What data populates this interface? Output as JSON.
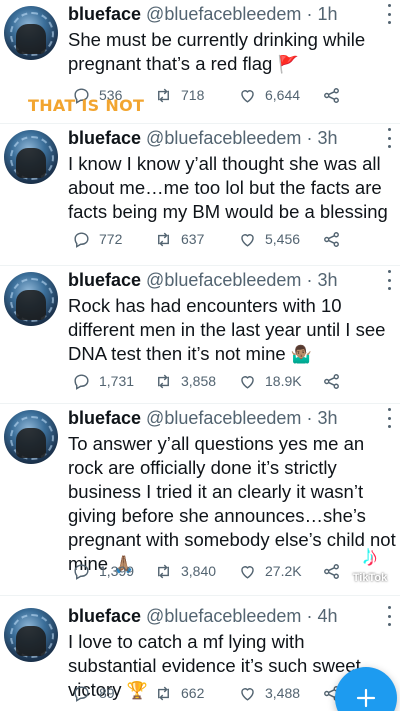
{
  "tweets": [
    {
      "name": "blueface",
      "handle": "@bluefacebleedem",
      "time": "1h",
      "text": "She must be currently drinking while pregnant that’s a red flag",
      "emoji": "🚩",
      "replies": "536",
      "retweets": "718",
      "likes": "6,644"
    },
    {
      "name": "blueface",
      "handle": "@bluefacebleedem",
      "time": "3h",
      "text": "I know I know y’all thought she was all about me…me too lol but the facts are facts being my BM would be a blessing",
      "emoji": "",
      "replies": "772",
      "retweets": "637",
      "likes": "5,456"
    },
    {
      "name": "blueface",
      "handle": "@bluefacebleedem",
      "time": "3h",
      "text": "Rock has had encounters with 10 different men in the last year until I see DNA test then it’s not mine",
      "emoji": "🤷🏽‍♂️",
      "replies": "1,731",
      "retweets": "3,858",
      "likes": "18.9K"
    },
    {
      "name": "blueface",
      "handle": "@bluefacebleedem",
      "time": "3h",
      "text": "To answer y’all questions yes me an rock are officially done it’s strictly business I tried it an clearly it wasn’t giving before she announces…she’s pregnant with somebody else’s child not mine",
      "emoji": "🙏🏽",
      "replies": "1,399",
      "retweets": "3,840",
      "likes": "27.2K"
    },
    {
      "name": "blueface",
      "handle": "@bluefacebleedem",
      "time": "4h",
      "text": "I love to catch a mf lying with substantial evidence it’s such sweet victory",
      "emoji": "🏆",
      "replies": "89",
      "retweets": "662",
      "likes": "3,488"
    }
  ],
  "overlay": {
    "caption": "THAT IS NOT",
    "tiktok_logo": "♪",
    "tiktok_word": "TikTok"
  },
  "icons": {
    "reply": "reply-icon",
    "retweet": "retweet-icon",
    "like": "heart-icon",
    "share": "share-icon",
    "more": "more-dots-icon",
    "compose": "compose-plus-icon"
  },
  "colors": {
    "accent": "#1d9bf0",
    "text": "#0f1419",
    "secondary": "#536471",
    "caption": "#f2a530"
  }
}
